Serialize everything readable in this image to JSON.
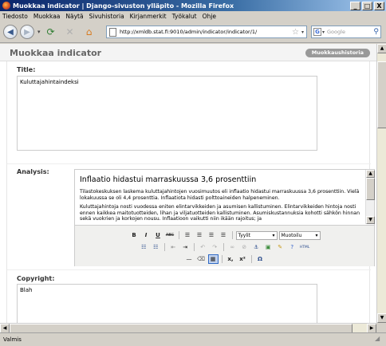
{
  "window": {
    "title": "Muokkaa indicator | Django-sivuston ylläpito - Mozilla Firefox",
    "minimize": "_",
    "maximize": "□",
    "close": "X"
  },
  "menu": [
    "Tiedosto",
    "Muokkaa",
    "Näytä",
    "Sivuhistoria",
    "Kirjanmerkit",
    "Työkalut",
    "Ohje"
  ],
  "nav": {
    "url": "http://xmldb.stat.fi:9010/admin/indicator/indicator/1/",
    "search_placeholder": "Google"
  },
  "page": {
    "title": "Muokkaa indicator",
    "history_button": "Muokkaushistoria"
  },
  "form": {
    "title_label": "Title:",
    "title_value": "Kuluttajahintaindeksi",
    "analysis_label": "Analysis:",
    "analysis_heading": "Inflaatio hidastui marraskuussa 3,6 prosenttiin",
    "analysis_p1": "Tilastokeskuksen laskema kuluttajahintojen vuosimuutos eli inflaatio hidastui marraskuussa 3,6 prosenttiin. Vielä lokakuussa se oli 4,4 prosenttia. Inflaatiota hidasti polttoaineiden halpeneminen.",
    "analysis_p2": "Kuluttajahintoja nosti vuodessa eniten elintarvikkeiden ja asumisen kallistuminen. Elintarvikkeiden hintoja nosti ennen kaikkea maitotuotteiden, lihan ja viljatuotteiden kallistuminen. Asumiskustannuksia kohotti sähkön hinnan sekä vuokrien ja korkojen nousu. Inflaatioon vaikutti niin ikään rajoitus; ja",
    "style_select": "Tyylit",
    "format_select": "Muotoilu",
    "copyright_label": "Copyright:",
    "copyright_value": "Blah"
  },
  "toolbar": {
    "bold": "B",
    "italic": "I",
    "underline": "U",
    "strike": "ABC",
    "subscript": "x,",
    "superscript": "x²",
    "omega": "Ω",
    "html": "HTML"
  },
  "status": {
    "text": "Valmis"
  }
}
